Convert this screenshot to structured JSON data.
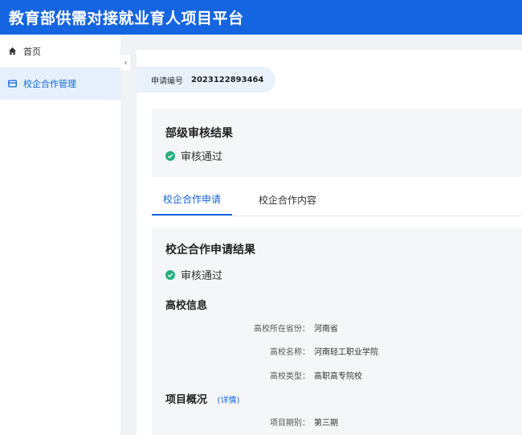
{
  "header": {
    "title": "教育部供需对接就业育人项目平台"
  },
  "sidebar": {
    "items": [
      {
        "label": "首页",
        "icon": "home-icon"
      },
      {
        "label": "校企合作管理",
        "icon": "card-icon"
      }
    ],
    "collapse_icon": "‹"
  },
  "application": {
    "label": "申请编号",
    "number": "2023122893464"
  },
  "ministry_review": {
    "title": "部级审核结果",
    "status": "审核通过"
  },
  "tabs": [
    {
      "label": "校企合作申请"
    },
    {
      "label": "校企合作内容"
    }
  ],
  "cooperation_result": {
    "title": "校企合作申请结果",
    "status": "审核通过",
    "school_section": "高校信息",
    "school_rows": [
      {
        "key": "高校所在省份：",
        "value": "河南省"
      },
      {
        "key": "高校名称：",
        "value": "河南轻工职业学院"
      },
      {
        "key": "高校类型：",
        "value": "高职高专院校"
      }
    ],
    "project_section": "项目概况",
    "project_detail_link": "(详情)",
    "project_rows": [
      {
        "key": "项目期别：",
        "value": "第三期"
      }
    ]
  },
  "colors": {
    "primary": "#1565e0",
    "success": "#22b07d"
  }
}
